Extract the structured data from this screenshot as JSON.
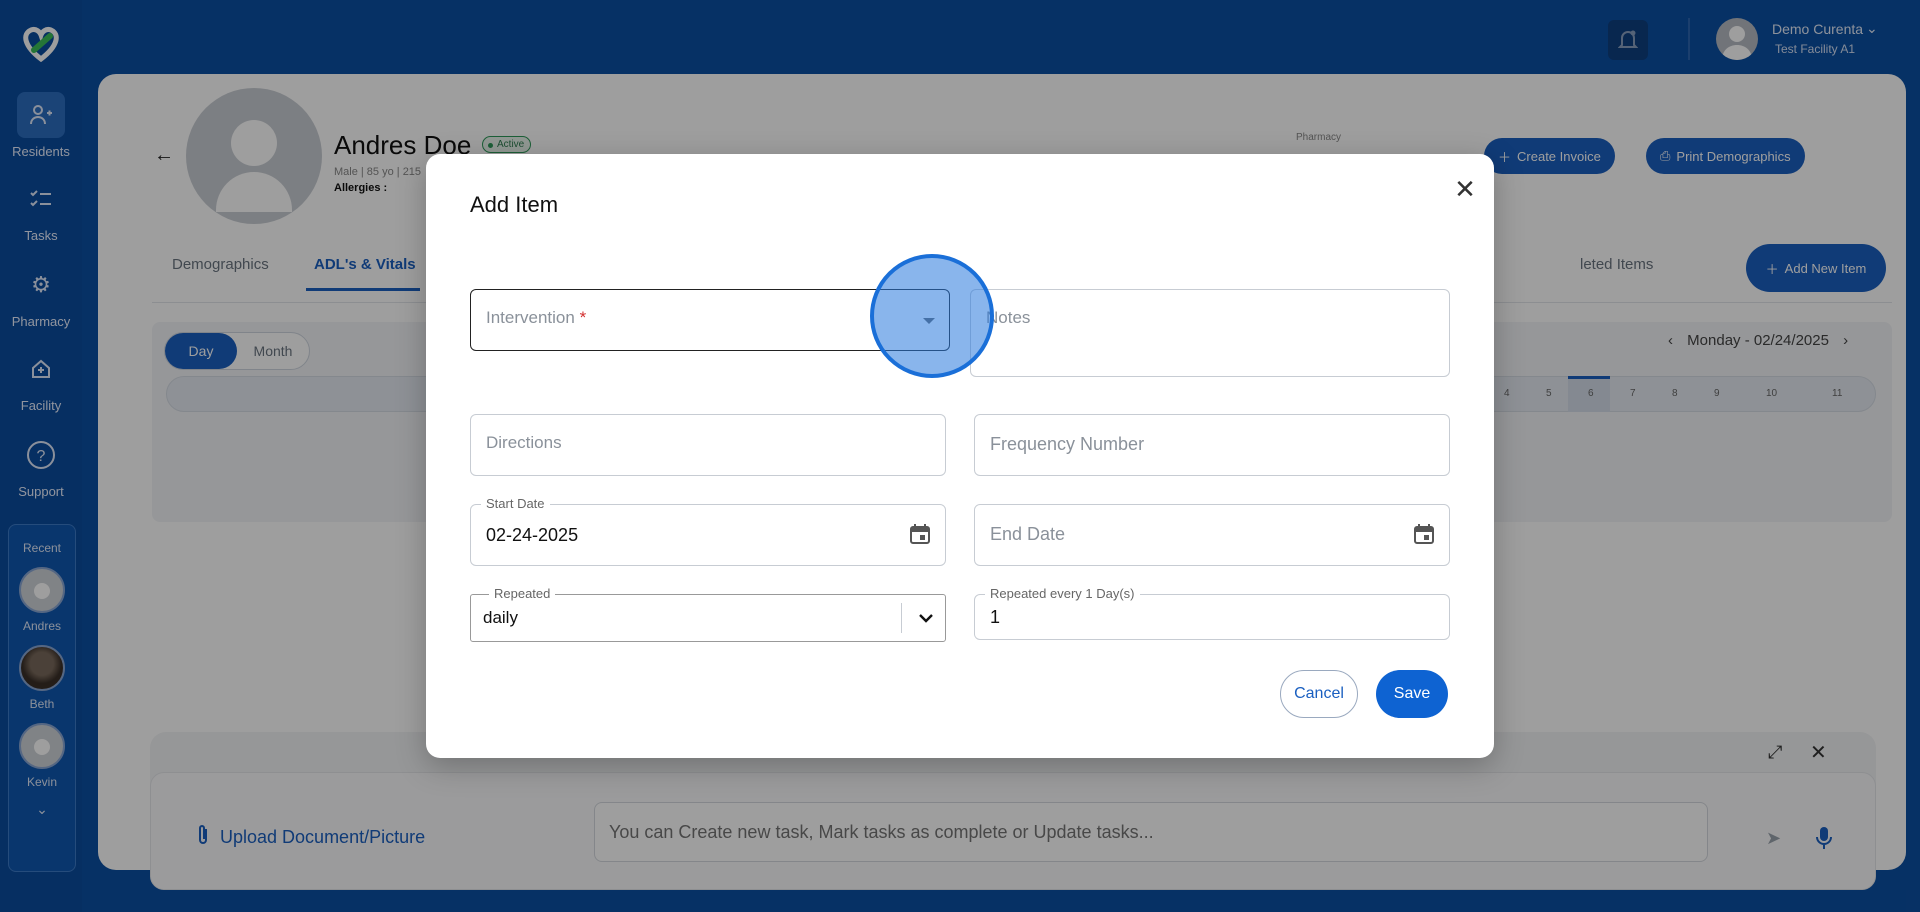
{
  "nav": {
    "items": [
      {
        "label": "Residents",
        "icon": "residents-icon"
      },
      {
        "label": "Tasks",
        "icon": "tasks-icon"
      },
      {
        "label": "Pharmacy",
        "icon": "gear-icon"
      },
      {
        "label": "Facility",
        "icon": "facility-icon"
      },
      {
        "label": "Support",
        "icon": "help-icon"
      }
    ],
    "recent_label": "Recent",
    "recent": [
      {
        "name": "Andres"
      },
      {
        "name": "Beth"
      },
      {
        "name": "Kevin"
      }
    ]
  },
  "header": {
    "user_name": "Demo Curenta",
    "facility": "Test Facility A1"
  },
  "resident": {
    "name": "Andres Doe",
    "status": "Active",
    "meta": "Male | 85 yo | 215",
    "allergies_label": "Allergies :",
    "pharmacy_label": "Pharmacy"
  },
  "actions": {
    "create_invoice": "Create Invoice",
    "print_demographics": "Print Demographics",
    "add_new_item": "Add New Item"
  },
  "tabs": [
    "Demographics",
    "ADL's & Vitals",
    "leted Items"
  ],
  "schedule": {
    "day": "Day",
    "month": "Month",
    "date": "Monday - 02/24/2025",
    "hours": [
      "4",
      "5",
      "6",
      "7",
      "8",
      "9",
      "10",
      "11"
    ]
  },
  "chat": {
    "upload_label": "Upload Document/Picture",
    "placeholder": "You can Create new task, Mark tasks as complete or Update tasks..."
  },
  "modal": {
    "title": "Add Item",
    "intervention_placeholder": "Intervention",
    "required_mark": "*",
    "notes_placeholder": "Notes",
    "directions_placeholder": "Directions",
    "frequency_placeholder": "Frequency Number",
    "start_date_label": "Start Date",
    "start_date_value": "02-24-2025",
    "end_date_placeholder": "End Date",
    "repeated_label": "Repeated",
    "repeated_value": "daily",
    "repeated_every_label": "Repeated every 1 Day(s)",
    "repeated_every_value": "1",
    "cancel": "Cancel",
    "save": "Save"
  },
  "colors": {
    "brand": "#0b4fa3",
    "accent": "#1a5fc0",
    "save": "#0e63d2",
    "active_green": "#2e9a59"
  }
}
